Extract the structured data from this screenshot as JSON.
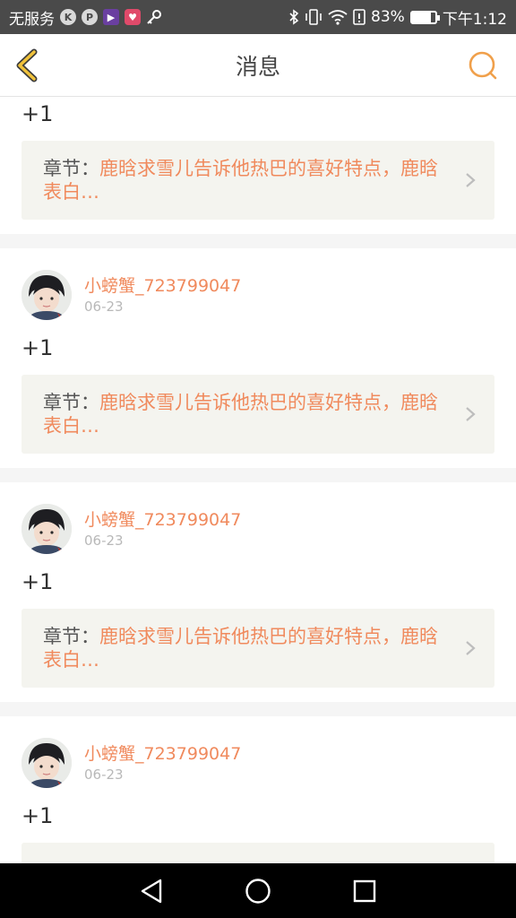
{
  "status_bar": {
    "carrier": "无服务",
    "apps": [
      "K",
      "P",
      "▶",
      "♥"
    ],
    "icons": [
      "key-icon",
      "bluetooth-icon",
      "vibrate-icon",
      "wifi-icon",
      "alert-icon",
      "battery-icon"
    ],
    "battery_percent": "83%",
    "battery_level": 0.83,
    "time": "下午1:12"
  },
  "header": {
    "title": "消息",
    "accent_color": "#f0a04b"
  },
  "messages": [
    {
      "reply": "+1",
      "chapter_prefix": "章节：",
      "chapter_title": "鹿晗求雪儿告诉他热巴的喜好特点，鹿晗表白…"
    },
    {
      "username": "小螃蟹_723799047",
      "date": "06-23",
      "reply": "+1",
      "chapter_prefix": "章节：",
      "chapter_title": "鹿晗求雪儿告诉他热巴的喜好特点，鹿晗表白…"
    },
    {
      "username": "小螃蟹_723799047",
      "date": "06-23",
      "reply": "+1",
      "chapter_prefix": "章节：",
      "chapter_title": "鹿晗求雪儿告诉他热巴的喜好特点，鹿晗表白…"
    },
    {
      "username": "小螃蟹_723799047",
      "date": "06-23",
      "reply": "+1"
    }
  ],
  "colors": {
    "username": "#f08a5d",
    "chapter_title": "#f08a5d",
    "card_bg": "#f4f4ef",
    "separator": "#f5f5f5"
  }
}
